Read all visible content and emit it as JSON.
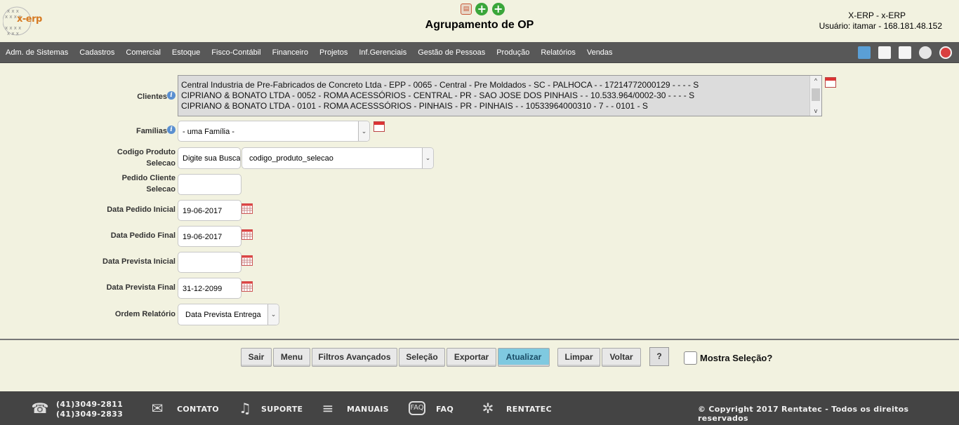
{
  "header": {
    "logo_text": "x-erp",
    "title": "Agrupamento de OP",
    "app_name": "X-ERP - x-ERP",
    "user_line": "Usuário: itamar - 168.181.48.152"
  },
  "menu": {
    "items": [
      "Adm. de Sistemas",
      "Cadastros",
      "Comercial",
      "Estoque",
      "Fisco-Contábil",
      "Financeiro",
      "Projetos",
      "Inf.Gerenciais",
      "Gestão de Pessoas",
      "Produção",
      "Relatórios",
      "Vendas"
    ]
  },
  "form": {
    "clientes_label": "Clientes",
    "clientes_rows": [
      "Central Industria de Pre-Fabricados de Concreto Ltda - EPP - 0065 - Central - Pre Moldados - SC - PALHOCA - - 17214772000129 - - - - S",
      "CIPRIANO & BONATO LTDA - 0052 - ROMA ACESSÓRIOS - CENTRAL - PR - SAO JOSE DOS PINHAIS - - 10.533.964/0002-30 - - - - S",
      "CIPRIANO & BONATO LTDA - 0101 - ROMA ACESSSÓRIOS - PINHAIS - PR - PINHAIS - - 10533964000310 - 7 - - 0101 - S"
    ],
    "familias_label": "Famílias",
    "familias_value": "- uma Família -",
    "codigo_label_1": "Codigo Produto",
    "codigo_label_2": "Selecao",
    "codigo_placeholder": "Digite sua Busca",
    "codigo_select": "codigo_produto_selecao",
    "pedido_label_1": "Pedido Cliente",
    "pedido_label_2": "Selecao",
    "pedido_value": "",
    "data_pedido_inicial_label": "Data Pedido Inicial",
    "data_pedido_inicial": "19-06-2017",
    "data_pedido_final_label": "Data Pedido Final",
    "data_pedido_final": "19-06-2017",
    "data_prevista_inicial_label": "Data Prevista Inicial",
    "data_prevista_inicial": "",
    "data_prevista_final_label": "Data Prevista Final",
    "data_prevista_final": "31-12-2099",
    "ordem_label": "Ordem Relatório",
    "ordem_value": "Data Prevista Entrega"
  },
  "toolbar": {
    "sair": "Sair",
    "menu": "Menu",
    "filtros": "Filtros Avançados",
    "selecao": "Seleção",
    "exportar": "Exportar",
    "atualizar": "Atualizar",
    "limpar": "Limpar",
    "voltar": "Voltar",
    "help": "?",
    "mostra_selecao": "Mostra Seleção?"
  },
  "footer": {
    "phone1": "(41)3049-2811",
    "phone2": "(41)3049-2833",
    "contato": "CONTATO",
    "suporte": "SUPORTE",
    "manuais": "MANUAIS",
    "faq": "FAQ",
    "rentatec": "RENTATEC",
    "copyright": "© Copyright 2017 Rentatec - Todos os direitos reservados"
  },
  "colors": {
    "background": "#f2f2e0",
    "menubar": "#585858",
    "footer": "#444444",
    "active_button": "#7fc9e0"
  }
}
